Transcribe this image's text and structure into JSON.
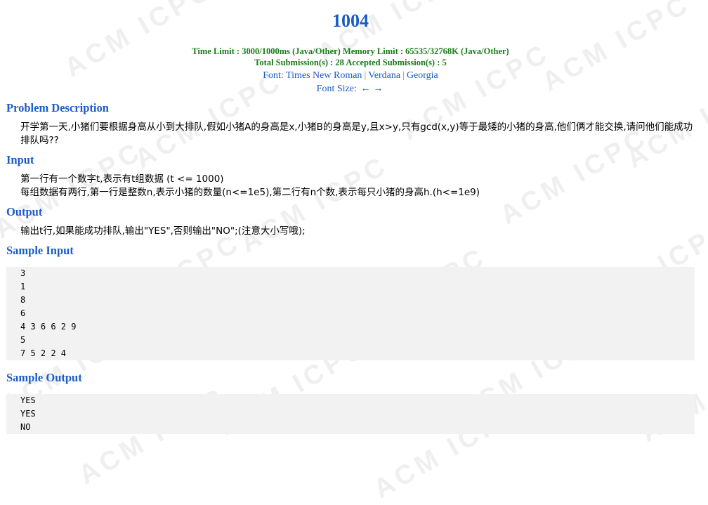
{
  "problem": {
    "id": "1004",
    "time_limit_line": "Time Limit : 3000/1000ms (Java/Other)   Memory Limit : 65535/32768K (Java/Other)",
    "submission_line": "Total Submission(s) : 28   Accepted Submission(s) : 5",
    "font_label": "Font:",
    "fonts": [
      "Times New Roman",
      "Verdana",
      "Georgia"
    ],
    "font_size_label": "Font Size:",
    "font_size_decrease": "←",
    "font_size_increase": "→"
  },
  "sections": {
    "description_title": "Problem Description",
    "description_text": "开学第一天,小猪们要根据身高从小到大排队,假如小猪A的身高是x,小猪B的身高是y,且x>y,只有gcd(x,y)等于最矮的小猪的身高,他们俩才能交换,请问他们能成功排队吗??",
    "input_title": "Input",
    "input_lines": [
      "第一行有一个数字t,表示有t组数据 (t <= 1000)",
      "每组数据有两行,第一行是整数n,表示小猪的数量(n<=1e5),第二行有n个数,表示每只小猪的身高h.(h<=1e9)"
    ],
    "output_title": "Output",
    "output_text": "输出t行,如果能成功排队,输出\"YES\",否则输出\"NO\";(注意大小写哦);",
    "sample_input_title": "Sample Input",
    "sample_input_lines": [
      "3",
      "1",
      "8",
      "6",
      "4 3 6 6 2 9",
      "5",
      "7 5 2 2 4"
    ],
    "sample_output_title": "Sample Output",
    "sample_output_lines": [
      "YES",
      "YES",
      "NO"
    ]
  },
  "watermark": "ACM ICPC"
}
